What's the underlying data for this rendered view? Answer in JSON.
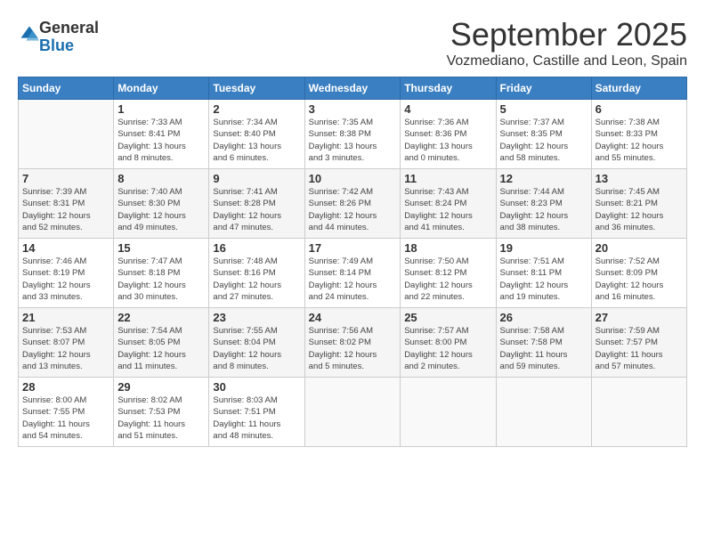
{
  "logo": {
    "general": "General",
    "blue": "Blue"
  },
  "header": {
    "month": "September 2025",
    "location": "Vozmediano, Castille and Leon, Spain"
  },
  "weekdays": [
    "Sunday",
    "Monday",
    "Tuesday",
    "Wednesday",
    "Thursday",
    "Friday",
    "Saturday"
  ],
  "weeks": [
    [
      {
        "day": "",
        "info": ""
      },
      {
        "day": "1",
        "info": "Sunrise: 7:33 AM\nSunset: 8:41 PM\nDaylight: 13 hours\nand 8 minutes."
      },
      {
        "day": "2",
        "info": "Sunrise: 7:34 AM\nSunset: 8:40 PM\nDaylight: 13 hours\nand 6 minutes."
      },
      {
        "day": "3",
        "info": "Sunrise: 7:35 AM\nSunset: 8:38 PM\nDaylight: 13 hours\nand 3 minutes."
      },
      {
        "day": "4",
        "info": "Sunrise: 7:36 AM\nSunset: 8:36 PM\nDaylight: 13 hours\nand 0 minutes."
      },
      {
        "day": "5",
        "info": "Sunrise: 7:37 AM\nSunset: 8:35 PM\nDaylight: 12 hours\nand 58 minutes."
      },
      {
        "day": "6",
        "info": "Sunrise: 7:38 AM\nSunset: 8:33 PM\nDaylight: 12 hours\nand 55 minutes."
      }
    ],
    [
      {
        "day": "7",
        "info": "Sunrise: 7:39 AM\nSunset: 8:31 PM\nDaylight: 12 hours\nand 52 minutes."
      },
      {
        "day": "8",
        "info": "Sunrise: 7:40 AM\nSunset: 8:30 PM\nDaylight: 12 hours\nand 49 minutes."
      },
      {
        "day": "9",
        "info": "Sunrise: 7:41 AM\nSunset: 8:28 PM\nDaylight: 12 hours\nand 47 minutes."
      },
      {
        "day": "10",
        "info": "Sunrise: 7:42 AM\nSunset: 8:26 PM\nDaylight: 12 hours\nand 44 minutes."
      },
      {
        "day": "11",
        "info": "Sunrise: 7:43 AM\nSunset: 8:24 PM\nDaylight: 12 hours\nand 41 minutes."
      },
      {
        "day": "12",
        "info": "Sunrise: 7:44 AM\nSunset: 8:23 PM\nDaylight: 12 hours\nand 38 minutes."
      },
      {
        "day": "13",
        "info": "Sunrise: 7:45 AM\nSunset: 8:21 PM\nDaylight: 12 hours\nand 36 minutes."
      }
    ],
    [
      {
        "day": "14",
        "info": "Sunrise: 7:46 AM\nSunset: 8:19 PM\nDaylight: 12 hours\nand 33 minutes."
      },
      {
        "day": "15",
        "info": "Sunrise: 7:47 AM\nSunset: 8:18 PM\nDaylight: 12 hours\nand 30 minutes."
      },
      {
        "day": "16",
        "info": "Sunrise: 7:48 AM\nSunset: 8:16 PM\nDaylight: 12 hours\nand 27 minutes."
      },
      {
        "day": "17",
        "info": "Sunrise: 7:49 AM\nSunset: 8:14 PM\nDaylight: 12 hours\nand 24 minutes."
      },
      {
        "day": "18",
        "info": "Sunrise: 7:50 AM\nSunset: 8:12 PM\nDaylight: 12 hours\nand 22 minutes."
      },
      {
        "day": "19",
        "info": "Sunrise: 7:51 AM\nSunset: 8:11 PM\nDaylight: 12 hours\nand 19 minutes."
      },
      {
        "day": "20",
        "info": "Sunrise: 7:52 AM\nSunset: 8:09 PM\nDaylight: 12 hours\nand 16 minutes."
      }
    ],
    [
      {
        "day": "21",
        "info": "Sunrise: 7:53 AM\nSunset: 8:07 PM\nDaylight: 12 hours\nand 13 minutes."
      },
      {
        "day": "22",
        "info": "Sunrise: 7:54 AM\nSunset: 8:05 PM\nDaylight: 12 hours\nand 11 minutes."
      },
      {
        "day": "23",
        "info": "Sunrise: 7:55 AM\nSunset: 8:04 PM\nDaylight: 12 hours\nand 8 minutes."
      },
      {
        "day": "24",
        "info": "Sunrise: 7:56 AM\nSunset: 8:02 PM\nDaylight: 12 hours\nand 5 minutes."
      },
      {
        "day": "25",
        "info": "Sunrise: 7:57 AM\nSunset: 8:00 PM\nDaylight: 12 hours\nand 2 minutes."
      },
      {
        "day": "26",
        "info": "Sunrise: 7:58 AM\nSunset: 7:58 PM\nDaylight: 11 hours\nand 59 minutes."
      },
      {
        "day": "27",
        "info": "Sunrise: 7:59 AM\nSunset: 7:57 PM\nDaylight: 11 hours\nand 57 minutes."
      }
    ],
    [
      {
        "day": "28",
        "info": "Sunrise: 8:00 AM\nSunset: 7:55 PM\nDaylight: 11 hours\nand 54 minutes."
      },
      {
        "day": "29",
        "info": "Sunrise: 8:02 AM\nSunset: 7:53 PM\nDaylight: 11 hours\nand 51 minutes."
      },
      {
        "day": "30",
        "info": "Sunrise: 8:03 AM\nSunset: 7:51 PM\nDaylight: 11 hours\nand 48 minutes."
      },
      {
        "day": "",
        "info": ""
      },
      {
        "day": "",
        "info": ""
      },
      {
        "day": "",
        "info": ""
      },
      {
        "day": "",
        "info": ""
      }
    ]
  ]
}
